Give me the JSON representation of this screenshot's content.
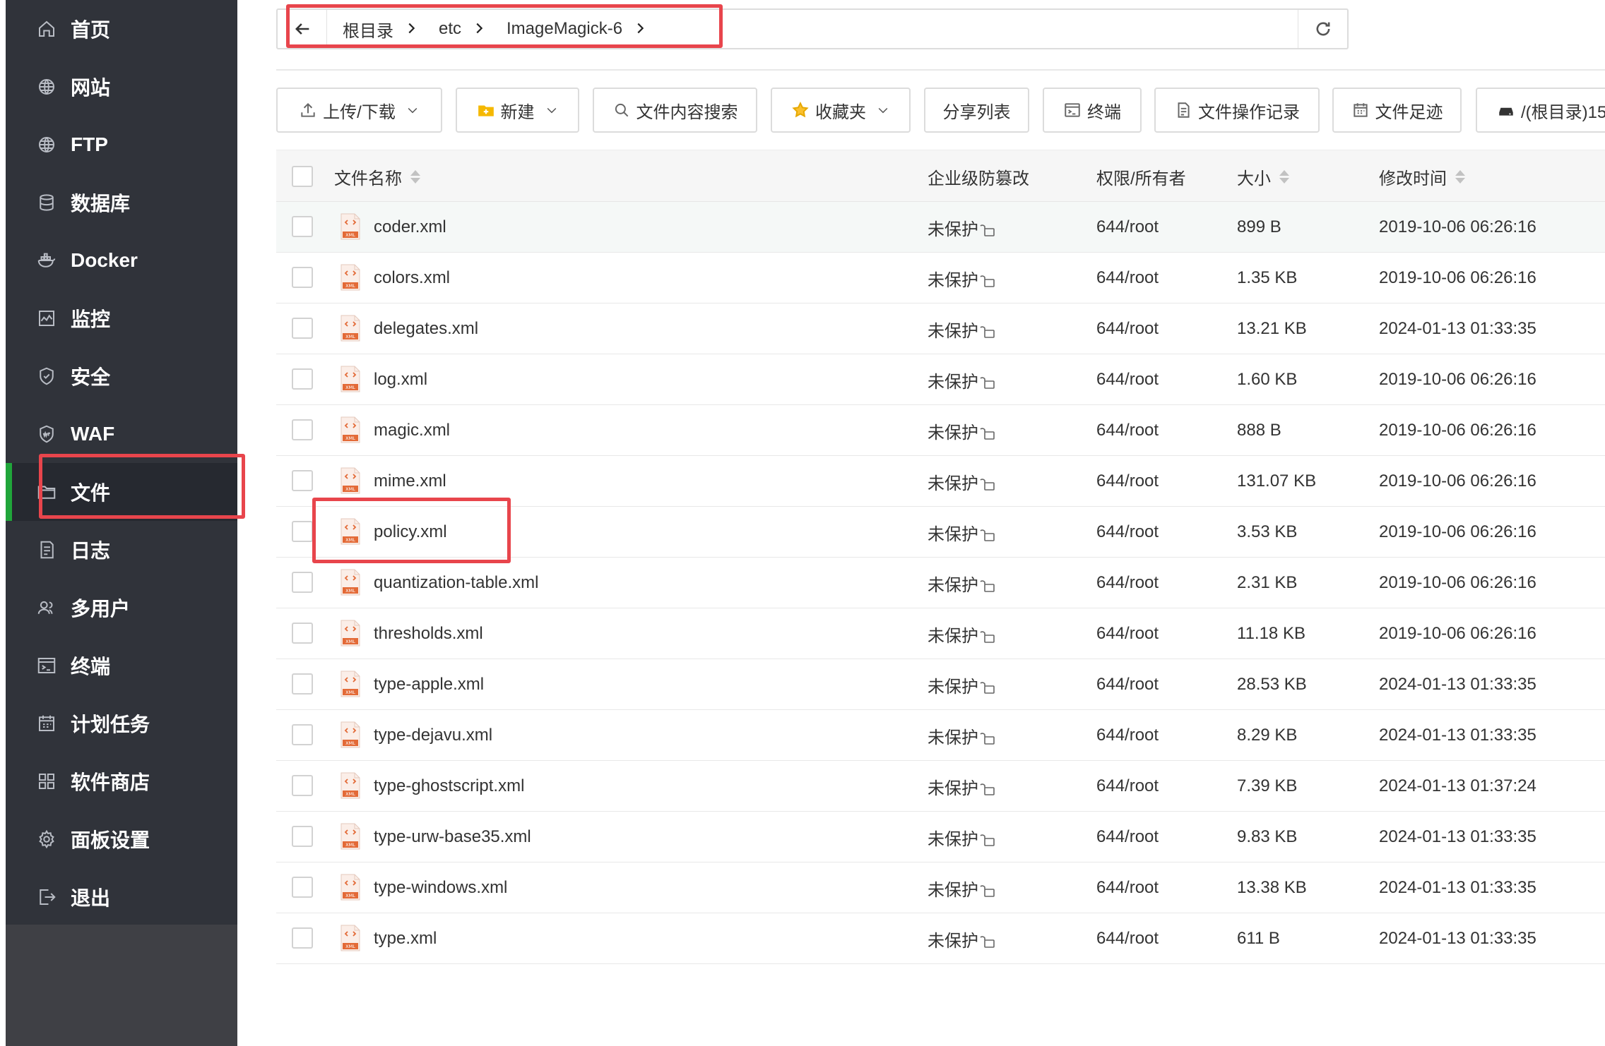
{
  "sidebar": {
    "items": [
      {
        "label": "首页",
        "icon": "home-icon",
        "name": "sidebar-item-home"
      },
      {
        "label": "网站",
        "icon": "globe-icon",
        "name": "sidebar-item-website"
      },
      {
        "label": "FTP",
        "icon": "globe-icon",
        "name": "sidebar-item-ftp"
      },
      {
        "label": "数据库",
        "icon": "database-icon",
        "name": "sidebar-item-database"
      },
      {
        "label": "Docker",
        "icon": "docker-icon",
        "name": "sidebar-item-docker"
      },
      {
        "label": "监控",
        "icon": "monitor-icon",
        "name": "sidebar-item-monitor"
      },
      {
        "label": "安全",
        "icon": "shield-icon",
        "name": "sidebar-item-security"
      },
      {
        "label": "WAF",
        "icon": "waf-shield-icon",
        "name": "sidebar-item-waf"
      },
      {
        "label": "文件",
        "icon": "folder-icon",
        "name": "sidebar-item-files",
        "active": true
      },
      {
        "label": "日志",
        "icon": "log-icon",
        "name": "sidebar-item-logs"
      },
      {
        "label": "多用户",
        "icon": "users-icon",
        "name": "sidebar-item-multiuser"
      },
      {
        "label": "终端",
        "icon": "terminal-icon",
        "name": "sidebar-item-terminal"
      },
      {
        "label": "计划任务",
        "icon": "calendar-icon",
        "name": "sidebar-item-cron"
      },
      {
        "label": "软件商店",
        "icon": "grid-icon",
        "name": "sidebar-item-store"
      },
      {
        "label": "面板设置",
        "icon": "gear-icon",
        "name": "sidebar-item-settings"
      },
      {
        "label": "退出",
        "icon": "logout-icon",
        "name": "sidebar-item-logout"
      }
    ],
    "accent_color": "#20a53a"
  },
  "path": {
    "crumbs": [
      "根目录",
      "etc",
      "ImageMagick-6"
    ]
  },
  "toolbar": {
    "upload_download": "上传/下载",
    "new": "新建",
    "content_search": "文件内容搜索",
    "favorites": "收藏夹",
    "share_list": "分享列表",
    "terminal": "终端",
    "operation_log": "文件操作记录",
    "footprint": "文件足迹",
    "disk": "/(根目录)15"
  },
  "table": {
    "headers": {
      "name": "文件名称",
      "tamper": "企业级防篡改",
      "perm": "权限/所有者",
      "size": "大小",
      "mtime": "修改时间"
    },
    "rows": [
      {
        "name": "coder.xml",
        "protect": "未保护",
        "perm": "644/root",
        "size": "899 B",
        "mtime": "2019-10-06 06:26:16"
      },
      {
        "name": "colors.xml",
        "protect": "未保护",
        "perm": "644/root",
        "size": "1.35 KB",
        "mtime": "2019-10-06 06:26:16"
      },
      {
        "name": "delegates.xml",
        "protect": "未保护",
        "perm": "644/root",
        "size": "13.21 KB",
        "mtime": "2024-01-13 01:33:35"
      },
      {
        "name": "log.xml",
        "protect": "未保护",
        "perm": "644/root",
        "size": "1.60 KB",
        "mtime": "2019-10-06 06:26:16"
      },
      {
        "name": "magic.xml",
        "protect": "未保护",
        "perm": "644/root",
        "size": "888 B",
        "mtime": "2019-10-06 06:26:16"
      },
      {
        "name": "mime.xml",
        "protect": "未保护",
        "perm": "644/root",
        "size": "131.07 KB",
        "mtime": "2019-10-06 06:26:16"
      },
      {
        "name": "policy.xml",
        "protect": "未保护",
        "perm": "644/root",
        "size": "3.53 KB",
        "mtime": "2019-10-06 06:26:16"
      },
      {
        "name": "quantization-table.xml",
        "protect": "未保护",
        "perm": "644/root",
        "size": "2.31 KB",
        "mtime": "2019-10-06 06:26:16"
      },
      {
        "name": "thresholds.xml",
        "protect": "未保护",
        "perm": "644/root",
        "size": "11.18 KB",
        "mtime": "2019-10-06 06:26:16"
      },
      {
        "name": "type-apple.xml",
        "protect": "未保护",
        "perm": "644/root",
        "size": "28.53 KB",
        "mtime": "2024-01-13 01:33:35"
      },
      {
        "name": "type-dejavu.xml",
        "protect": "未保护",
        "perm": "644/root",
        "size": "8.29 KB",
        "mtime": "2024-01-13 01:33:35"
      },
      {
        "name": "type-ghostscript.xml",
        "protect": "未保护",
        "perm": "644/root",
        "size": "7.39 KB",
        "mtime": "2024-01-13 01:37:24"
      },
      {
        "name": "type-urw-base35.xml",
        "protect": "未保护",
        "perm": "644/root",
        "size": "9.83 KB",
        "mtime": "2024-01-13 01:33:35"
      },
      {
        "name": "type-windows.xml",
        "protect": "未保护",
        "perm": "644/root",
        "size": "13.38 KB",
        "mtime": "2024-01-13 01:33:35"
      },
      {
        "name": "type.xml",
        "protect": "未保护",
        "perm": "644/root",
        "size": "611 B",
        "mtime": "2024-01-13 01:33:35"
      }
    ]
  },
  "highlight_color": "#e8454c"
}
